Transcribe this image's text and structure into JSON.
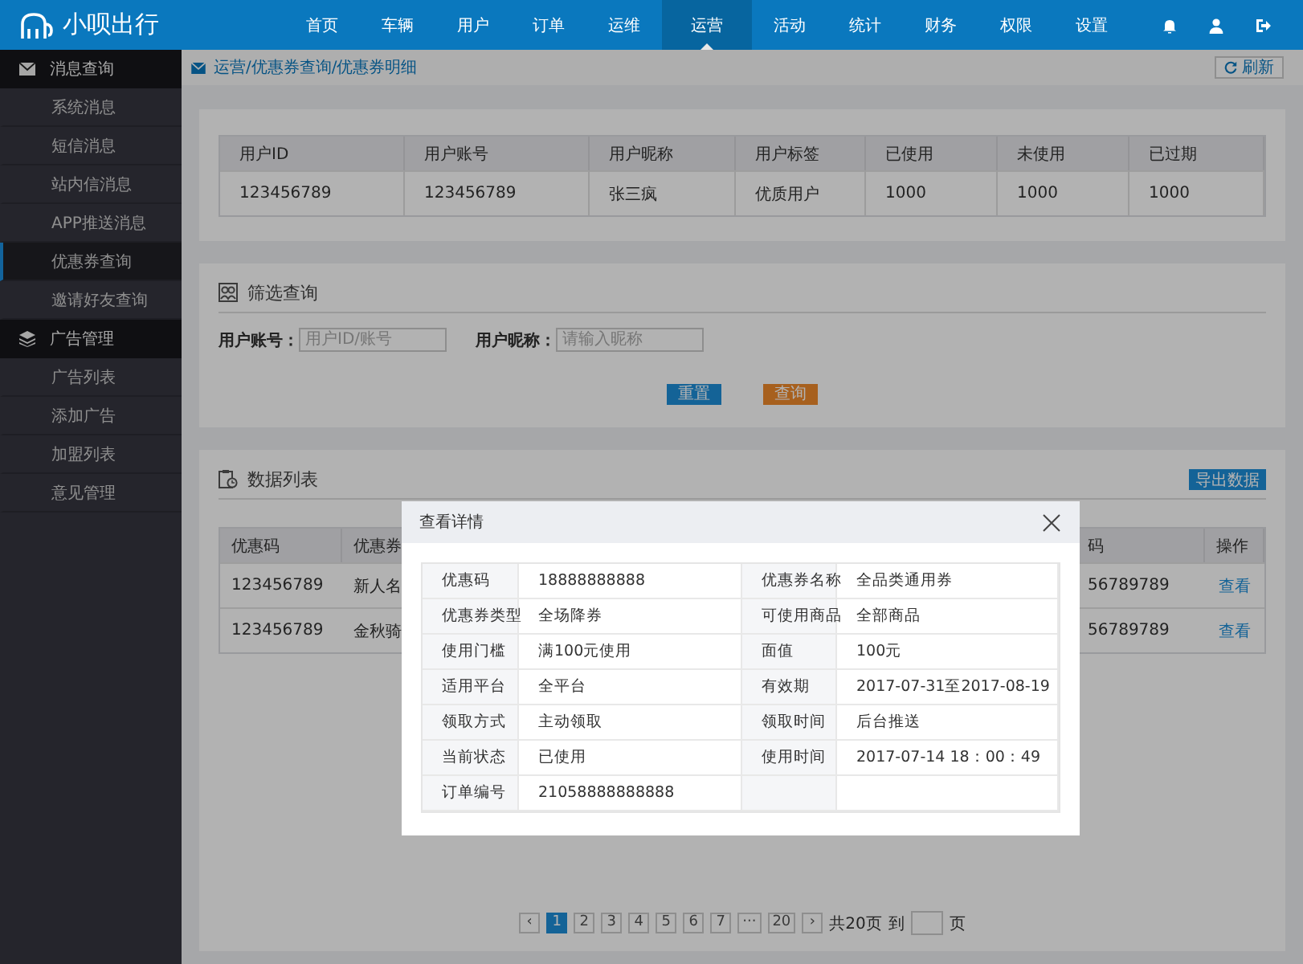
{
  "app": {
    "logo": "小呗出行"
  },
  "nav": [
    {
      "label": "首页",
      "selected": false
    },
    {
      "label": "车辆",
      "selected": false
    },
    {
      "label": "用户",
      "selected": false
    },
    {
      "label": "订单",
      "selected": false
    },
    {
      "label": "运维",
      "selected": false
    },
    {
      "label": "运营",
      "selected": true
    },
    {
      "label": "活动",
      "selected": false
    },
    {
      "label": "统计",
      "selected": false
    },
    {
      "label": "财务",
      "selected": false
    },
    {
      "label": "权限",
      "selected": false
    },
    {
      "label": "设置",
      "selected": false
    }
  ],
  "sidebar": {
    "groups": [
      {
        "label": "消息查询",
        "children": [
          {
            "label": "系统消息",
            "selected": false
          },
          {
            "label": "短信消息",
            "selected": false
          },
          {
            "label": "站内信消息",
            "selected": false
          },
          {
            "label": "APP推送消息",
            "selected": false
          },
          {
            "label": "优惠券查询",
            "selected": true
          },
          {
            "label": "邀请好友查询",
            "selected": false
          }
        ]
      },
      {
        "label": "广告管理",
        "children": [
          {
            "label": "广告列表",
            "selected": false
          },
          {
            "label": "添加广告",
            "selected": false
          },
          {
            "label": "加盟列表",
            "selected": false
          },
          {
            "label": "意见管理",
            "selected": false
          }
        ]
      }
    ]
  },
  "breadcrumb": "运营/优惠券查询/优惠券明细",
  "refresh_button": "刷新",
  "user_summary": {
    "columns": [
      "用户ID",
      "用户账号",
      "用户昵称",
      "用户标签",
      "已使用",
      "未使用",
      "已过期"
    ],
    "rows": [
      [
        "123456789",
        "123456789",
        "张三疯",
        "优质用户",
        "1000",
        "1000",
        "1000"
      ]
    ]
  },
  "filter": {
    "title": "筛选查询",
    "fields": [
      {
        "label": "用户账号：",
        "placeholder": "用户ID/账号"
      },
      {
        "label": "用户昵称：",
        "placeholder": "请输入昵称"
      }
    ],
    "buttons": [
      {
        "label": "重置",
        "kind": "primary"
      },
      {
        "label": "查询",
        "kind": "warning"
      }
    ]
  },
  "data_list": {
    "title": "数据列表",
    "export_button": "导出数据",
    "columns": [
      "优惠码",
      "优惠券",
      "码",
      "操作"
    ],
    "rows": [
      {
        "cells": [
          "123456789",
          "新人名",
          "56789789"
        ],
        "action": "查看"
      },
      {
        "cells": [
          "123456789",
          "金秋骑",
          "56789789"
        ],
        "action": "查看"
      }
    ]
  },
  "pagination": {
    "prev": "‹",
    "pages": [
      {
        "label": "1",
        "selected": true
      },
      {
        "label": "2",
        "selected": false
      },
      {
        "label": "3",
        "selected": false
      },
      {
        "label": "4",
        "selected": false
      },
      {
        "label": "5",
        "selected": false
      },
      {
        "label": "6",
        "selected": false
      },
      {
        "label": "7",
        "selected": false
      },
      {
        "label": "···",
        "selected": false
      },
      {
        "label": "20",
        "selected": false
      }
    ],
    "next": "›",
    "total": "共20页",
    "goto": "到",
    "unit": "页"
  },
  "modal": {
    "title": "查看详情",
    "fields": [
      {
        "label": "优惠码",
        "value": "18888888888"
      },
      {
        "label": "优惠券名称",
        "value": "全品类通用券"
      },
      {
        "label": "优惠券类型",
        "value": "全场降券"
      },
      {
        "label": "可使用商品",
        "value": "全部商品"
      },
      {
        "label": "使用门槛",
        "value": "满100元使用"
      },
      {
        "label": "面值",
        "value": "100元"
      },
      {
        "label": "适用平台",
        "value": "全平台"
      },
      {
        "label": "有效期",
        "value": "2017-07-31至2017-08-19"
      },
      {
        "label": "领取方式",
        "value": "主动领取"
      },
      {
        "label": "领取时间",
        "value": "后台推送"
      },
      {
        "label": "当前状态",
        "value": "已使用"
      },
      {
        "label": "使用时间",
        "value": "2017-07-14 18：00：49"
      },
      {
        "label": "订单编号",
        "value": "21058888888888"
      }
    ]
  }
}
